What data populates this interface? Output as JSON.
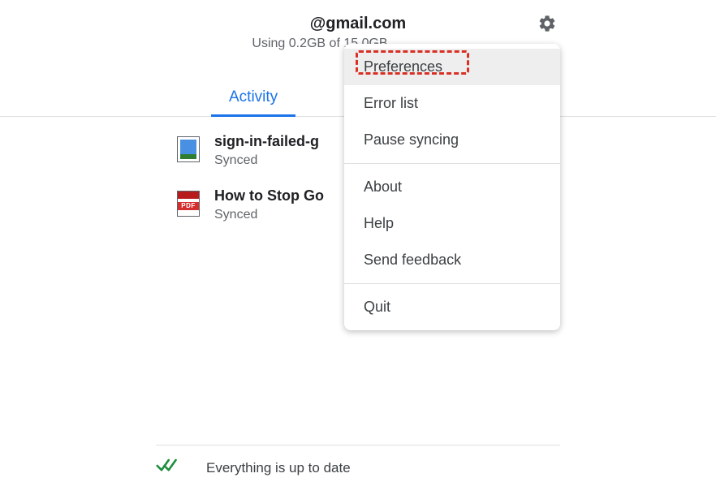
{
  "header": {
    "email": "@gmail.com",
    "storage_text": "Using 0.2GB of 15.0GB"
  },
  "tabs": {
    "activity": "Activity"
  },
  "files": [
    {
      "name": "sign-in-failed-g",
      "status": "Synced",
      "kind": "image"
    },
    {
      "name": "How to Stop Go",
      "status": "Synced",
      "kind": "pdf",
      "badge": "PDF"
    }
  ],
  "menu": {
    "preferences": "Preferences",
    "error_list": "Error list",
    "pause_syncing": "Pause syncing",
    "about": "About",
    "help": "Help",
    "send_feedback": "Send feedback",
    "quit": "Quit"
  },
  "footer": {
    "status": "Everything is up to date"
  }
}
